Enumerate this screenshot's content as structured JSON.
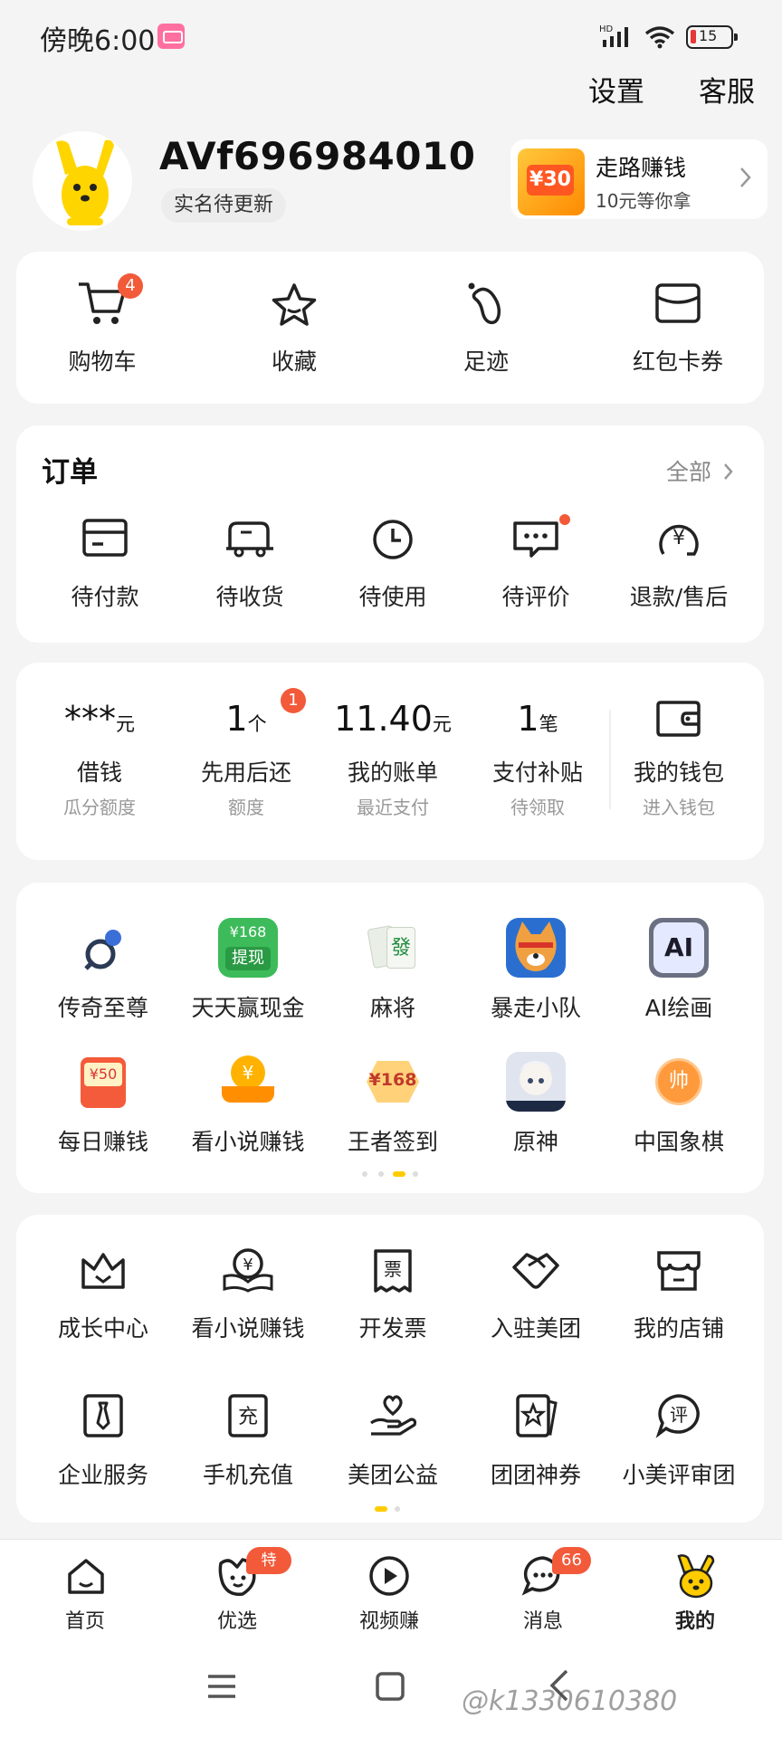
{
  "status_bar": {
    "time": "傍晚6:00",
    "network": "HD",
    "battery": "15"
  },
  "top_actions": {
    "settings": "设置",
    "service": "客服"
  },
  "profile": {
    "username": "AVf696984010",
    "verify_tag": "实名待更新",
    "promo": {
      "title": "走路赚钱",
      "subtitle": "10元等你拿",
      "thumb_text": "¥30"
    }
  },
  "quick_links": [
    {
      "label": "购物车",
      "icon": "cart-icon",
      "badge": "4"
    },
    {
      "label": "收藏",
      "icon": "star-icon"
    },
    {
      "label": "足迹",
      "icon": "footprint-icon"
    },
    {
      "label": "红包卡券",
      "icon": "coupon-icon"
    }
  ],
  "orders": {
    "title": "订单",
    "all": "全部",
    "items": [
      {
        "label": "待付款",
        "icon": "card-icon"
      },
      {
        "label": "待收货",
        "icon": "truck-icon"
      },
      {
        "label": "待使用",
        "icon": "clock-icon"
      },
      {
        "label": "待评价",
        "icon": "comment-icon"
      },
      {
        "label": "退款/售后",
        "icon": "refund-icon"
      }
    ]
  },
  "finance": [
    {
      "value": "***",
      "unit": "元",
      "label": "借钱",
      "sub": "瓜分额度"
    },
    {
      "value": "1",
      "unit": "个",
      "label": "先用后还",
      "sub": "额度",
      "badge": "1"
    },
    {
      "value": "11.40",
      "unit": "元",
      "label": "我的账单",
      "sub": "最近支付"
    },
    {
      "value": "1",
      "unit": "笔",
      "label": "支付补贴",
      "sub": "待领取"
    },
    {
      "label": "我的钱包",
      "sub": "进入钱包",
      "icon": "wallet-icon"
    }
  ],
  "apps": [
    {
      "label": "传奇至尊",
      "icon": "legend-game-icon",
      "color": "#3b6fd8"
    },
    {
      "label": "天天赢现金",
      "icon": "cash-withdraw-icon",
      "color": "#3dbb5a",
      "text": "¥168",
      "text2": "提现"
    },
    {
      "label": "麻将",
      "icon": "mahjong-icon",
      "color": "#e9efe6",
      "text": "發"
    },
    {
      "label": "暴走小队",
      "icon": "dog-game-icon",
      "color": "#f0a040"
    },
    {
      "label": "AI绘画",
      "icon": "ai-paint-icon",
      "color": "#c9d0ff",
      "text": "AI"
    },
    {
      "label": "每日赚钱",
      "icon": "daily-money-icon",
      "color": "#f45b3a",
      "text": "¥50"
    },
    {
      "label": "看小说赚钱",
      "icon": "novel-money-icon",
      "color": "#ffb300",
      "text": "¥"
    },
    {
      "label": "王者签到",
      "icon": "king-checkin-icon",
      "color": "#ffd27a",
      "text": "¥168"
    },
    {
      "label": "原神",
      "icon": "genshin-icon",
      "color": "#dfe4ee"
    },
    {
      "label": "中国象棋",
      "icon": "chess-icon",
      "color": "#ff9a3c",
      "text": "帅"
    }
  ],
  "services": [
    {
      "label": "成长中心",
      "icon": "crown-icon"
    },
    {
      "label": "看小说赚钱",
      "icon": "novel-coin-icon"
    },
    {
      "label": "开发票",
      "icon": "invoice-icon"
    },
    {
      "label": "入驻美团",
      "icon": "handshake-icon"
    },
    {
      "label": "我的店铺",
      "icon": "shop-icon"
    },
    {
      "label": "企业服务",
      "icon": "tie-icon"
    },
    {
      "label": "手机充值",
      "icon": "recharge-icon",
      "text": "充"
    },
    {
      "label": "美团公益",
      "icon": "charity-icon"
    },
    {
      "label": "团团神券",
      "icon": "voucher-icon"
    },
    {
      "label": "小美评审团",
      "icon": "review-icon",
      "text": "评"
    }
  ],
  "bottom_nav": [
    {
      "label": "首页",
      "icon": "home-icon"
    },
    {
      "label": "优选",
      "icon": "youxuan-icon",
      "badge": "特价"
    },
    {
      "label": "视频赚",
      "icon": "video-icon"
    },
    {
      "label": "消息",
      "icon": "message-icon",
      "badge": "66"
    },
    {
      "label": "我的",
      "icon": "mine-icon",
      "active": true
    }
  ],
  "watermark": "@k1330610380",
  "colors": {
    "accent": "#ffcc00",
    "badge": "#f25a3a",
    "background": "#f4f4f4"
  }
}
